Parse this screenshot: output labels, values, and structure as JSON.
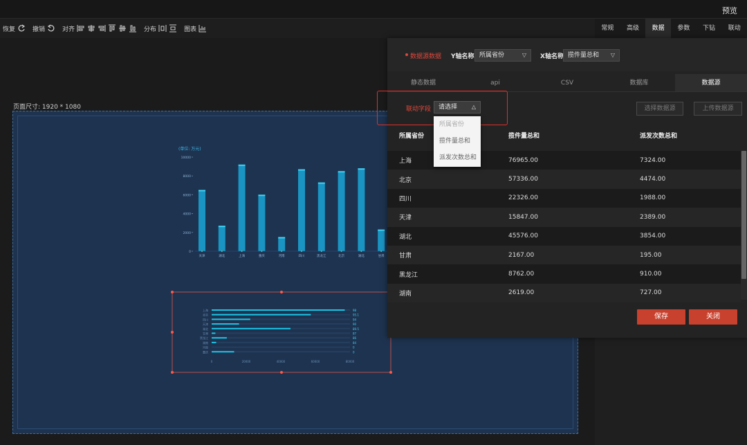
{
  "topbar": {
    "preview": "预览"
  },
  "toolbar": {
    "redo": "恢复",
    "undo": "撤销",
    "align": "对齐",
    "distribute": "分布",
    "chart": "图表"
  },
  "prop_tabs": [
    "常规",
    "高级",
    "数据",
    "参数",
    "下钻",
    "联动"
  ],
  "active_prop_tab": "数据",
  "canvas": {
    "page_size_label": "页面尺寸: 1920 * 1080"
  },
  "dialog": {
    "datasource_label": "数据源数据",
    "y_axis_label": "Y轴名称",
    "y_axis_value": "所属省份",
    "x_axis_label": "X轴名称",
    "x_axis_value": "揽件量总和",
    "tabs": [
      "静态数据",
      "api",
      "CSV",
      "数据库",
      "数据源"
    ],
    "active_tab": "数据源",
    "link_field_label": "联动字段",
    "link_field_placeholder": "请选择",
    "dropdown_options": [
      "所属省份",
      "揽件量总和",
      "派发次数总和"
    ],
    "select_ds_button": "选择数据源",
    "upload_ds_button": "上传数据源",
    "table": {
      "headers": [
        "所属省份",
        "揽件量总和",
        "派发次数总和"
      ],
      "rows": [
        [
          "上海",
          "76965.00",
          "7324.00"
        ],
        [
          "北京",
          "57336.00",
          "4474.00"
        ],
        [
          "四川",
          "22326.00",
          "1988.00"
        ],
        [
          "天津",
          "15847.00",
          "2389.00"
        ],
        [
          "湖北",
          "45576.00",
          "3854.00"
        ],
        [
          "甘肃",
          "2167.00",
          "195.00"
        ],
        [
          "黑龙江",
          "8762.00",
          "910.00"
        ],
        [
          "湖南",
          "2619.00",
          "727.00"
        ]
      ]
    },
    "save_button": "保存",
    "close_button": "关闭"
  },
  "chart_data": [
    {
      "type": "bar",
      "title": "(单位: 万元)",
      "categories": [
        "天津",
        "湖北",
        "上海",
        "重庆",
        "河南",
        "四川",
        "黑龙江",
        "北京",
        "湖北",
        "甘肃"
      ],
      "values": [
        6400,
        2600,
        9100,
        5900,
        1400,
        8600,
        7200,
        8400,
        8700,
        2200
      ],
      "ylim": [
        0,
        10000
      ],
      "yticks": [
        "0",
        "2000",
        "4000",
        "6000",
        "8000",
        "10000"
      ],
      "colors": {
        "bar": "#1aa6d6",
        "bar_top": "#3fd3f5"
      }
    },
    {
      "type": "bar",
      "orientation": "horizontal",
      "categories": [
        "上海",
        "北京",
        "四川",
        "天津",
        "湖北",
        "甘肃",
        "黑龙江",
        "湖南",
        "河南",
        "重庆"
      ],
      "values": [
        76965,
        57336,
        22326,
        15847,
        45576,
        2167,
        8762,
        2619,
        0,
        13000
      ],
      "labels": [
        "98",
        "95.1",
        "94",
        "90",
        "89.5",
        "87",
        "86",
        "84",
        "0",
        "0"
      ],
      "xlim": [
        0,
        80000
      ],
      "xticks": [
        "0",
        "20000",
        "40000",
        "60000",
        "80000"
      ],
      "colors": {
        "bar": "#19c6e8"
      }
    }
  ]
}
